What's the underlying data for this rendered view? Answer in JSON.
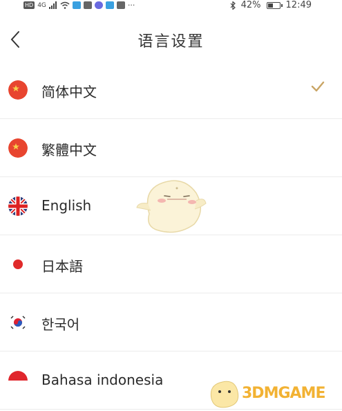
{
  "statusbar": {
    "network": "4G",
    "battery_text": "42%",
    "battery_level": 0.42,
    "time": "12:49"
  },
  "header": {
    "title": "语言设置",
    "back_icon": "chevron-left-icon"
  },
  "languages": [
    {
      "label": "简体中文",
      "flag": "china-flag-icon",
      "selected": true
    },
    {
      "label": "繁體中文",
      "flag": "china-flag-icon",
      "selected": false
    },
    {
      "label": "English",
      "flag": "uk-flag-icon",
      "selected": false
    },
    {
      "label": "日本語",
      "flag": "japan-flag-icon",
      "selected": false
    },
    {
      "label": "한국어",
      "flag": "korea-flag-icon",
      "selected": false
    },
    {
      "label": "Bahasa indonesia",
      "flag": "indonesia-flag-icon",
      "selected": false
    }
  ],
  "watermark": {
    "text": "3DMGAME"
  },
  "colors": {
    "check": "#c9a565",
    "china_red": "#e8452f",
    "japan_red": "#e02a2a"
  }
}
